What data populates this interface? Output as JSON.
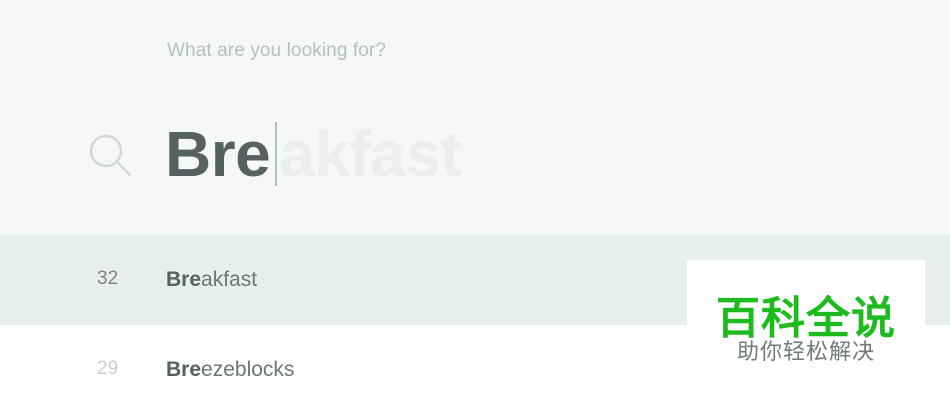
{
  "search": {
    "prompt": "What are you looking for?",
    "typed_text": "Bre",
    "autocomplete_suffix": "akfast",
    "icon": "search-icon"
  },
  "results": [
    {
      "count": "32",
      "match": "Bre",
      "rest": "akfast"
    },
    {
      "count": "29",
      "match": "Bre",
      "rest": "ezeblocks"
    }
  ],
  "watermark": {
    "main": "百科全说",
    "sub": "助你轻松解决"
  },
  "colors": {
    "panel_bg": "#f6f7f7",
    "highlight_row": "#e8eded",
    "text_dark": "#566262",
    "watermark_green": "#1dbb1d"
  }
}
